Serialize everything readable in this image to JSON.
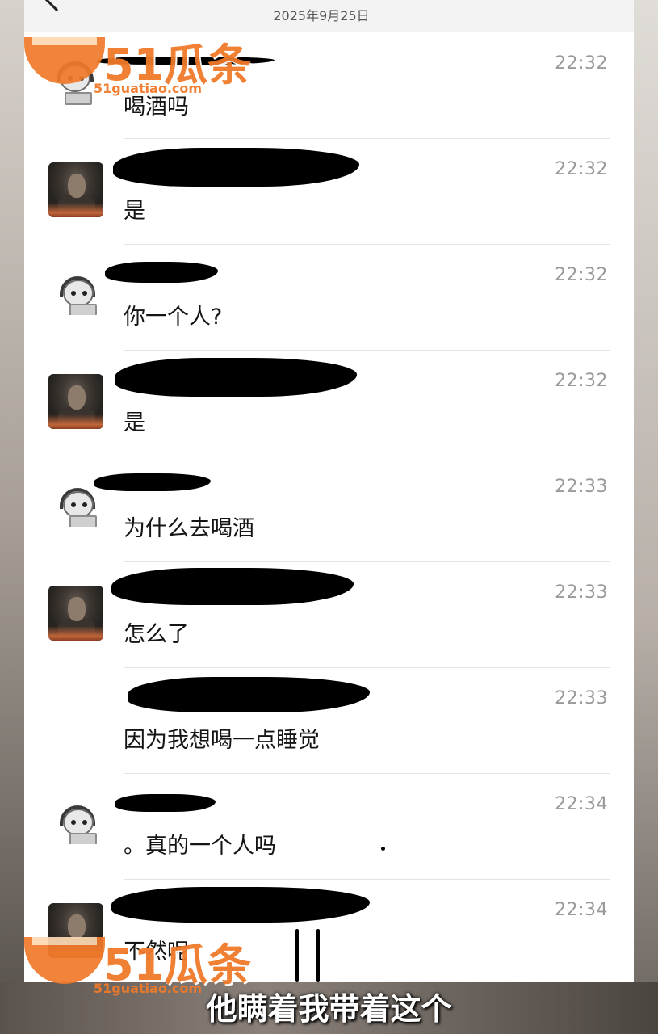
{
  "header": {
    "date": "2025年9月25日"
  },
  "messages": [
    {
      "sender": "cat",
      "time": "22:32",
      "text": "喝酒吗"
    },
    {
      "sender": "photo",
      "time": "22:32",
      "text": "是"
    },
    {
      "sender": "cat",
      "time": "22:32",
      "text": "你一个人?"
    },
    {
      "sender": "photo",
      "time": "22:32",
      "text": "是"
    },
    {
      "sender": "cat",
      "time": "22:33",
      "text": "为什么去喝酒"
    },
    {
      "sender": "photo",
      "time": "22:33",
      "text": "怎么了"
    },
    {
      "sender": "photo",
      "time": "22:33",
      "text": "因为我想喝一点睡觉"
    },
    {
      "sender": "cat",
      "time": "22:34",
      "text": "。真的一个人吗"
    },
    {
      "sender": "photo",
      "time": "22:34",
      "text": "不然呢"
    }
  ],
  "subtitle": "他瞒着我带着这个",
  "watermark": {
    "brand": "51瓜条",
    "domain": "51guatiao.com"
  },
  "colors": {
    "watermark": "#f07a2a",
    "time": "#9a9a9a",
    "divider": "#e4e4e4"
  }
}
